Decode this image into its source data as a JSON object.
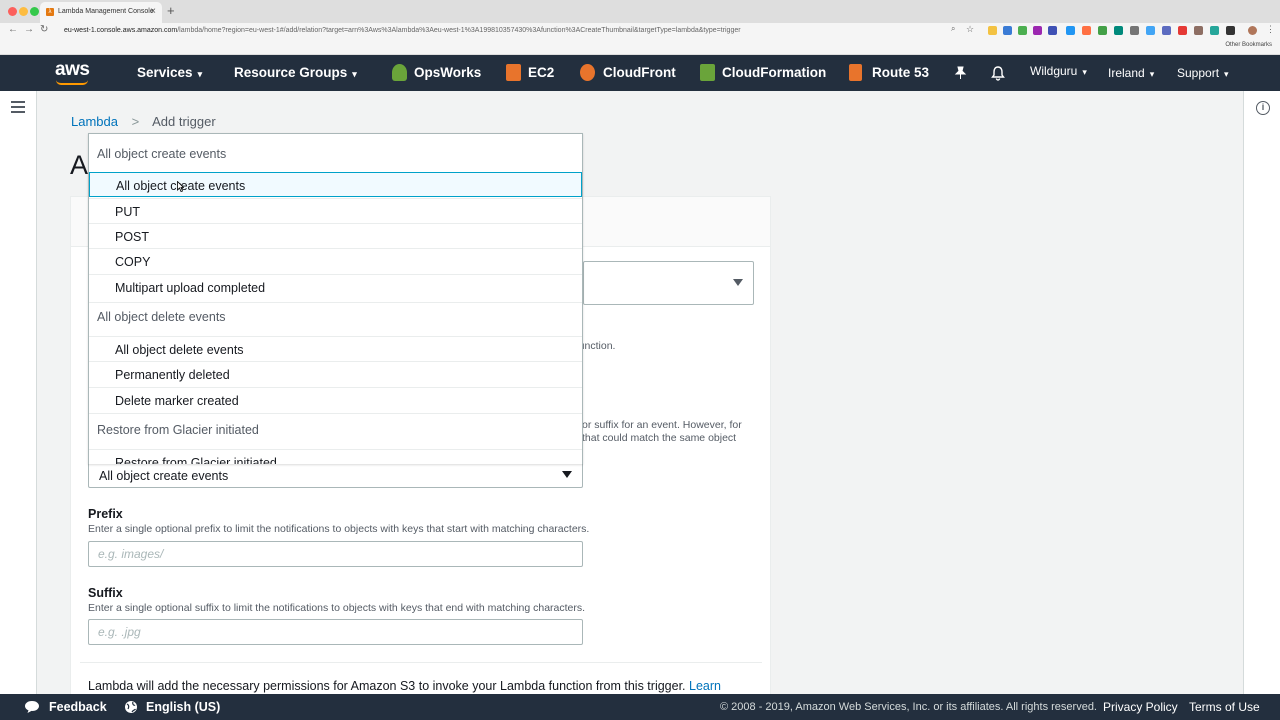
{
  "browser": {
    "tab_title": "Lambda Management Console",
    "tab_favicon": "λ",
    "new_tab": "+",
    "close": "×",
    "url_host": "eu-west-1.console.aws.amazon.com",
    "url_path": "/lambda/home?region=eu-west-1#/add/relation?target=arn%3Aws%3Alambda%3Aeu-west-1%3A199810357430%3Afunction%3ACreateThumbnail&targetType=lambda&type=trigger",
    "other_bookmarks": "Other Bookmarks"
  },
  "header": {
    "logo": "aws",
    "services": "Services",
    "resource_groups": "Resource Groups",
    "opsworks": "OpsWorks",
    "ec2": "EC2",
    "cloudfront": "CloudFront",
    "cloudformation": "CloudFormation",
    "route53": "Route 53",
    "user": "Wildguru",
    "region": "Ireland",
    "support": "Support",
    "caret": "▾"
  },
  "breadcrumb": {
    "lambda": "Lambda",
    "separator": ">",
    "current": "Add trigger"
  },
  "page": {
    "title_partial": "A",
    "behind_text_1": "e function.",
    "behind_text_2": "or suffix for an event. However, for",
    "behind_text_3": "that could match the same object"
  },
  "dropdown": {
    "groups": [
      {
        "label": "All object create events",
        "options": [
          "All object create events",
          "PUT",
          "POST",
          "COPY",
          "Multipart upload completed"
        ]
      },
      {
        "label": "All object delete events",
        "options": [
          "All object delete events",
          "Permanently deleted",
          "Delete marker created"
        ]
      },
      {
        "label": "Restore from Glacier initiated",
        "options": [
          "Restore from Glacier initiated"
        ]
      }
    ],
    "highlighted": "All object create events"
  },
  "event_type": {
    "selected": "All object create events"
  },
  "prefix": {
    "label": "Prefix",
    "description": "Enter a single optional prefix to limit the notifications to objects with keys that start with matching characters.",
    "placeholder": "e.g. images/"
  },
  "suffix": {
    "label": "Suffix",
    "description": "Enter a single optional suffix to limit the notifications to objects with keys that end with matching characters.",
    "placeholder": "e.g. .jpg"
  },
  "permissions": {
    "text": "Lambda will add the necessary permissions for Amazon S3 to invoke your Lambda function from this trigger.",
    "link": "Learn"
  },
  "footer": {
    "feedback": "Feedback",
    "language": "English (US)",
    "copyright": "© 2008 - 2019, Amazon Web Services, Inc. or its affiliates. All rights reserved.",
    "privacy": "Privacy Policy",
    "terms": "Terms of Use"
  },
  "colors": {
    "nav_bg": "#232f3e",
    "aws_orange": "#ff9900",
    "link": "#0073bb",
    "select_highlight": "#00a1c9"
  }
}
